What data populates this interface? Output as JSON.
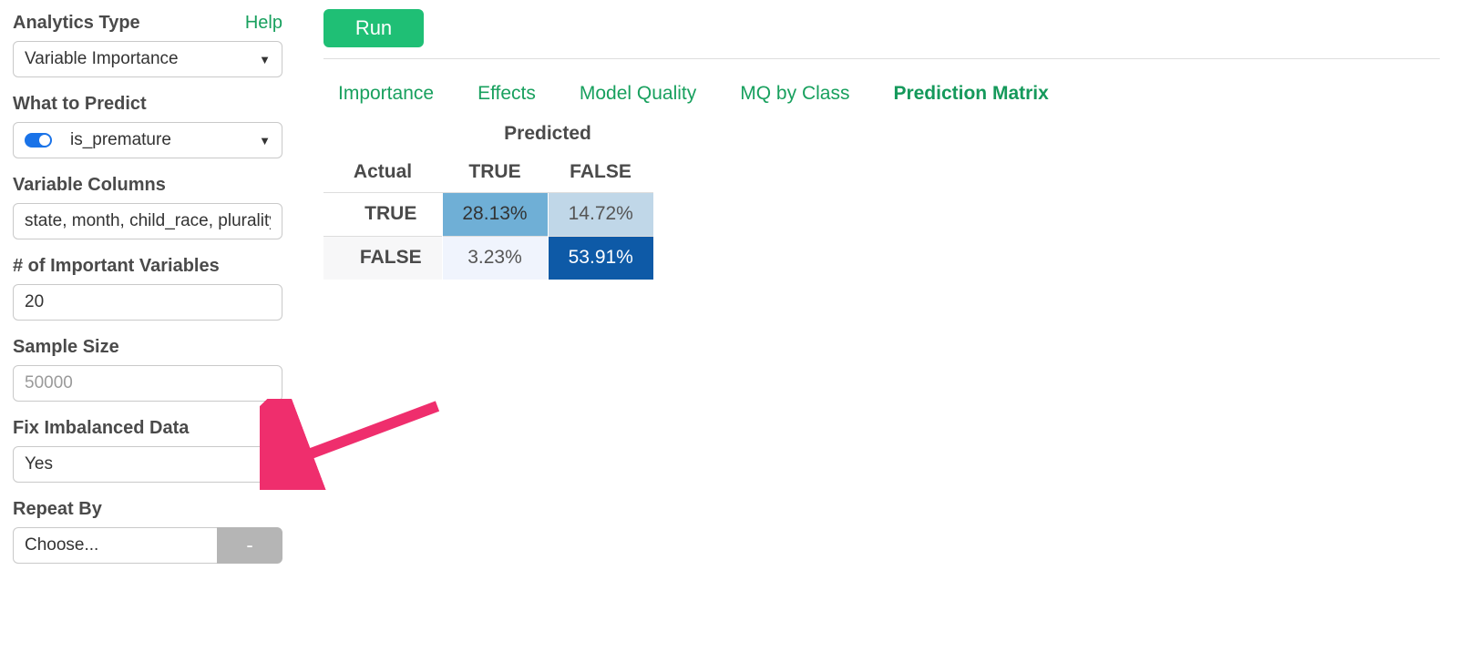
{
  "sidebar": {
    "analytics_type": {
      "label": "Analytics Type",
      "help": "Help",
      "value": "Variable Importance"
    },
    "what_to_predict": {
      "label": "What to Predict",
      "value": "is_premature"
    },
    "variable_columns": {
      "label": "Variable Columns",
      "value": "state, month, child_race, plurality"
    },
    "important_vars": {
      "label": "# of Important Variables",
      "value": "20"
    },
    "sample_size": {
      "label": "Sample Size",
      "placeholder": "50000"
    },
    "fix_imbalanced": {
      "label": "Fix Imbalanced Data",
      "value": "Yes"
    },
    "repeat_by": {
      "label": "Repeat By",
      "value": "Choose...",
      "minus": "-"
    }
  },
  "main": {
    "run": "Run",
    "tabs": {
      "importance": "Importance",
      "effects": "Effects",
      "model_quality": "Model Quality",
      "mq_by_class": "MQ by Class",
      "prediction_matrix": "Prediction Matrix"
    },
    "matrix": {
      "predicted": "Predicted",
      "actual": "Actual",
      "col_true": "TRUE",
      "col_false": "FALSE",
      "row_true": "TRUE",
      "row_false": "FALSE",
      "tp": "28.13%",
      "fn": "14.72%",
      "fp": "3.23%",
      "tn": "53.91%"
    }
  },
  "chart_data": {
    "type": "table",
    "title": "Prediction Matrix",
    "row_label": "Actual",
    "col_label": "Predicted",
    "categories": [
      "TRUE",
      "FALSE"
    ],
    "values": [
      [
        28.13,
        14.72
      ],
      [
        3.23,
        53.91
      ]
    ],
    "unit": "percent"
  }
}
